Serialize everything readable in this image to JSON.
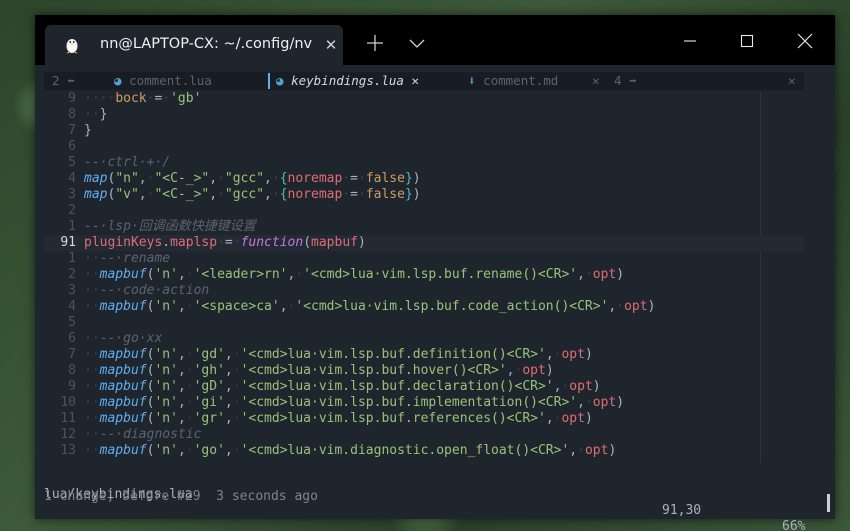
{
  "window": {
    "tab_title": "nn@LAPTOP-CX: ~/.config/nvim",
    "close_tab_label": "✕",
    "new_tab_label": "+",
    "controls": [
      "minimize",
      "maximize",
      "close"
    ]
  },
  "bufferline": {
    "left_count": "2",
    "right_count": "4",
    "buffers": [
      {
        "label": "comment.lua",
        "icon": "lua-icon",
        "active": false
      },
      {
        "label": "keybindings.lua",
        "icon": "lua-icon",
        "active": true,
        "close": "✕"
      },
      {
        "label": "comment.md",
        "icon": "markdown-icon",
        "active": false,
        "close": "✕"
      }
    ],
    "close_all": "✕"
  },
  "lines": [
    {
      "n": "9",
      "code": [
        [
          "ws",
          "····"
        ],
        [
          "y",
          "bock"
        ],
        [
          "ws",
          "·"
        ],
        [
          "p",
          "="
        ],
        [
          "ws",
          "·"
        ],
        [
          "s",
          "'gb'"
        ]
      ]
    },
    {
      "n": "8",
      "code": [
        [
          "ws",
          "··"
        ],
        [
          "p",
          "}"
        ]
      ]
    },
    {
      "n": "7",
      "code": [
        [
          "p",
          "}"
        ]
      ]
    },
    {
      "n": "6",
      "code": []
    },
    {
      "n": "5",
      "code": [
        [
          "c",
          "--·ctrl·+·/"
        ]
      ]
    },
    {
      "n": "4",
      "code": [
        [
          "f",
          "map"
        ],
        [
          "p",
          "("
        ],
        [
          "s",
          "\"n\""
        ],
        [
          "p",
          ","
        ],
        [
          "ws",
          "·"
        ],
        [
          "s",
          "\"<C-_>\""
        ],
        [
          "p",
          ","
        ],
        [
          "ws",
          "·"
        ],
        [
          "s",
          "\"gcc\""
        ],
        [
          "p",
          ","
        ],
        [
          "ws",
          "·"
        ],
        [
          "b2",
          "{"
        ],
        [
          "k",
          "noremap"
        ],
        [
          "ws",
          "·"
        ],
        [
          "p",
          "="
        ],
        [
          "ws",
          "·"
        ],
        [
          "y",
          "false"
        ],
        [
          "b2",
          "}"
        ],
        [
          "p",
          ")"
        ]
      ]
    },
    {
      "n": "3",
      "code": [
        [
          "f",
          "map"
        ],
        [
          "p",
          "("
        ],
        [
          "s",
          "\"v\""
        ],
        [
          "p",
          ","
        ],
        [
          "ws",
          "·"
        ],
        [
          "s",
          "\"<C-_>\""
        ],
        [
          "p",
          ","
        ],
        [
          "ws",
          "·"
        ],
        [
          "s",
          "\"gcc\""
        ],
        [
          "p",
          ","
        ],
        [
          "ws",
          "·"
        ],
        [
          "b2",
          "{"
        ],
        [
          "k",
          "noremap"
        ],
        [
          "ws",
          "·"
        ],
        [
          "p",
          "="
        ],
        [
          "ws",
          "·"
        ],
        [
          "y",
          "false"
        ],
        [
          "b2",
          "}"
        ],
        [
          "p",
          ")"
        ]
      ]
    },
    {
      "n": "2",
      "code": []
    },
    {
      "n": "1",
      "code": [
        [
          "c",
          "--·lsp·回调函数快捷键设置"
        ]
      ]
    },
    {
      "n": "91",
      "cur": true,
      "code": [
        [
          "k",
          "pluginKeys"
        ],
        [
          "p",
          "."
        ],
        [
          "k",
          "maplsp"
        ],
        [
          "ws",
          "·"
        ],
        [
          "p",
          "="
        ],
        [
          "ws",
          "·"
        ],
        [
          "kw",
          "function"
        ],
        [
          "p",
          "("
        ],
        [
          "k",
          "mapbuf"
        ],
        [
          "p",
          ")"
        ]
      ]
    },
    {
      "n": "1",
      "code": [
        [
          "ws",
          "··"
        ],
        [
          "c",
          "--·rename"
        ]
      ]
    },
    {
      "n": "2",
      "code": [
        [
          "ws",
          "··"
        ],
        [
          "f",
          "mapbuf"
        ],
        [
          "p",
          "("
        ],
        [
          "s",
          "'n'"
        ],
        [
          "p",
          ","
        ],
        [
          "ws",
          "·"
        ],
        [
          "s",
          "'<leader>rn'"
        ],
        [
          "p",
          ","
        ],
        [
          "ws",
          "·"
        ],
        [
          "s",
          "'<cmd>lua·vim.lsp.buf.rename()<CR>'"
        ],
        [
          "p",
          ","
        ],
        [
          "ws",
          "·"
        ],
        [
          "k",
          "opt"
        ],
        [
          "p",
          ")"
        ]
      ]
    },
    {
      "n": "3",
      "code": [
        [
          "ws",
          "··"
        ],
        [
          "c",
          "--·code·action"
        ]
      ]
    },
    {
      "n": "4",
      "code": [
        [
          "ws",
          "··"
        ],
        [
          "f",
          "mapbuf"
        ],
        [
          "p",
          "("
        ],
        [
          "s",
          "'n'"
        ],
        [
          "p",
          ","
        ],
        [
          "ws",
          "·"
        ],
        [
          "s",
          "'<space>ca'"
        ],
        [
          "p",
          ","
        ],
        [
          "ws",
          "·"
        ],
        [
          "s",
          "'<cmd>lua·vim.lsp.buf.code_action()<CR>'"
        ],
        [
          "p",
          ","
        ],
        [
          "ws",
          "·"
        ],
        [
          "k",
          "opt"
        ],
        [
          "p",
          ")"
        ]
      ]
    },
    {
      "n": "5",
      "code": []
    },
    {
      "n": "6",
      "code": [
        [
          "ws",
          "··"
        ],
        [
          "c",
          "--·go·xx"
        ]
      ]
    },
    {
      "n": "7",
      "code": [
        [
          "ws",
          "··"
        ],
        [
          "f",
          "mapbuf"
        ],
        [
          "p",
          "("
        ],
        [
          "s",
          "'n'"
        ],
        [
          "p",
          ","
        ],
        [
          "ws",
          "·"
        ],
        [
          "s",
          "'gd'"
        ],
        [
          "p",
          ","
        ],
        [
          "ws",
          "·"
        ],
        [
          "s",
          "'<cmd>lua·vim.lsp.buf.definition()<CR>'"
        ],
        [
          "p",
          ","
        ],
        [
          "ws",
          "·"
        ],
        [
          "k",
          "opt"
        ],
        [
          "p",
          ")"
        ]
      ]
    },
    {
      "n": "8",
      "code": [
        [
          "ws",
          "··"
        ],
        [
          "f",
          "mapbuf"
        ],
        [
          "p",
          "("
        ],
        [
          "s",
          "'n'"
        ],
        [
          "p",
          ","
        ],
        [
          "ws",
          "·"
        ],
        [
          "s",
          "'gh'"
        ],
        [
          "p",
          ","
        ],
        [
          "ws",
          "·"
        ],
        [
          "s",
          "'<cmd>lua·vim.lsp.buf.hover()<CR>'"
        ],
        [
          "p",
          ","
        ],
        [
          "ws",
          "·"
        ],
        [
          "k",
          "opt"
        ],
        [
          "p",
          ")"
        ]
      ]
    },
    {
      "n": "9",
      "code": [
        [
          "ws",
          "··"
        ],
        [
          "f",
          "mapbuf"
        ],
        [
          "p",
          "("
        ],
        [
          "s",
          "'n'"
        ],
        [
          "p",
          ","
        ],
        [
          "ws",
          "·"
        ],
        [
          "s",
          "'gD'"
        ],
        [
          "p",
          ","
        ],
        [
          "ws",
          "·"
        ],
        [
          "s",
          "'<cmd>lua·vim.lsp.buf.declaration()<CR>'"
        ],
        [
          "p",
          ","
        ],
        [
          "ws",
          "·"
        ],
        [
          "k",
          "opt"
        ],
        [
          "p",
          ")"
        ]
      ]
    },
    {
      "n": "10",
      "code": [
        [
          "ws",
          "··"
        ],
        [
          "f",
          "mapbuf"
        ],
        [
          "p",
          "("
        ],
        [
          "s",
          "'n'"
        ],
        [
          "p",
          ","
        ],
        [
          "ws",
          "·"
        ],
        [
          "s",
          "'gi'"
        ],
        [
          "p",
          ","
        ],
        [
          "ws",
          "·"
        ],
        [
          "s",
          "'<cmd>lua·vim.lsp.buf.implementation()<CR>'"
        ],
        [
          "p",
          ","
        ],
        [
          "ws",
          "·"
        ],
        [
          "k",
          "opt"
        ],
        [
          "p",
          ")"
        ]
      ]
    },
    {
      "n": "11",
      "code": [
        [
          "ws",
          "··"
        ],
        [
          "f",
          "mapbuf"
        ],
        [
          "p",
          "("
        ],
        [
          "s",
          "'n'"
        ],
        [
          "p",
          ","
        ],
        [
          "ws",
          "·"
        ],
        [
          "s",
          "'gr'"
        ],
        [
          "p",
          ","
        ],
        [
          "ws",
          "·"
        ],
        [
          "s",
          "'<cmd>lua·vim.lsp.buf.references()<CR>'"
        ],
        [
          "p",
          ","
        ],
        [
          "ws",
          "·"
        ],
        [
          "k",
          "opt"
        ],
        [
          "p",
          ")"
        ]
      ]
    },
    {
      "n": "12",
      "code": [
        [
          "ws",
          "··"
        ],
        [
          "c",
          "--·diagnostic"
        ]
      ]
    },
    {
      "n": "13",
      "code": [
        [
          "ws",
          "··"
        ],
        [
          "f",
          "mapbuf"
        ],
        [
          "p",
          "("
        ],
        [
          "s",
          "'n'"
        ],
        [
          "p",
          ","
        ],
        [
          "ws",
          "·"
        ],
        [
          "s",
          "'go'"
        ],
        [
          "p",
          ","
        ],
        [
          "ws",
          "·"
        ],
        [
          "s",
          "'<cmd>lua·vim.diagnostic.open_float()<CR>'"
        ],
        [
          "p",
          ","
        ],
        [
          "ws",
          "·"
        ],
        [
          "k",
          "opt"
        ],
        [
          "p",
          ")"
        ]
      ]
    }
  ],
  "status": {
    "file": "lua/keybindings.lua",
    "position": "91,30",
    "percent": "66%"
  },
  "cmdline": "1 change; before #29  3 seconds ago"
}
